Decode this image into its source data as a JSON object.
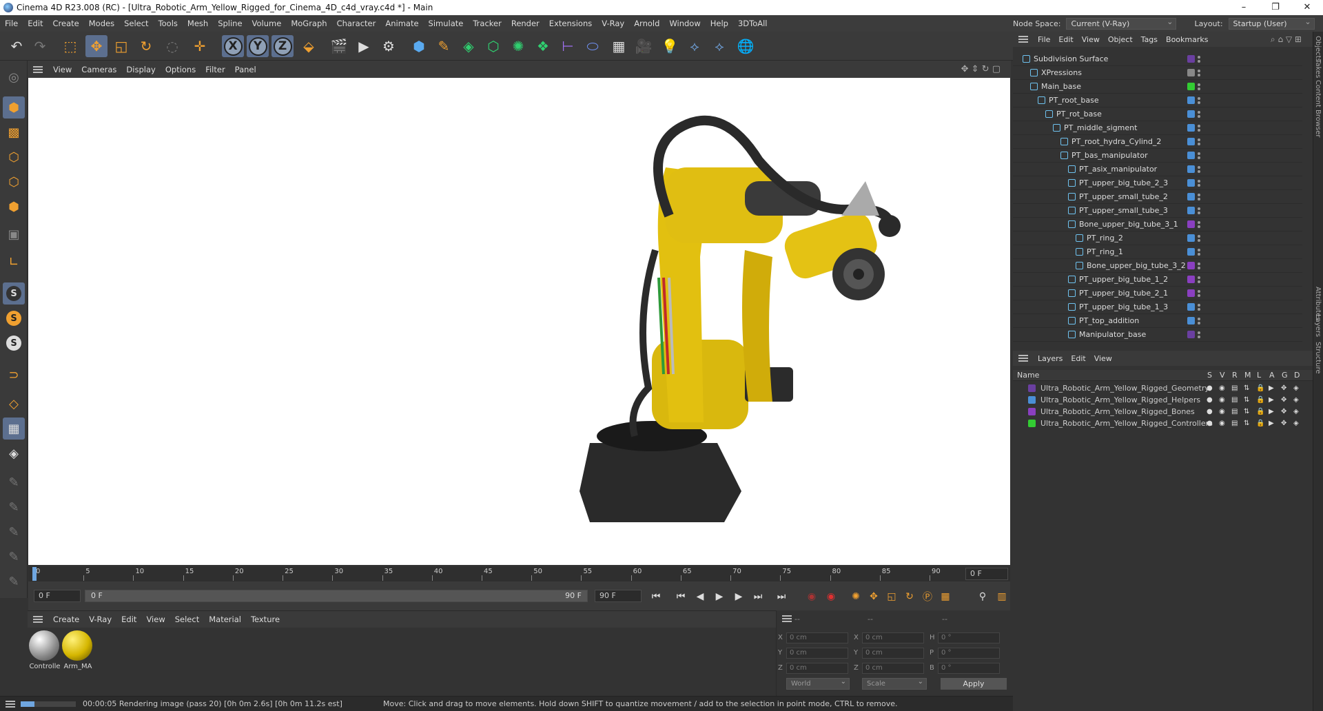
{
  "window": {
    "title": "Cinema 4D R23.008 (RC) - [Ultra_Robotic_Arm_Yellow_Rigged_for_Cinema_4D_c4d_vray.c4d *] - Main",
    "min": "–",
    "max": "❐",
    "close": "✕"
  },
  "menu": [
    "File",
    "Edit",
    "Create",
    "Modes",
    "Select",
    "Tools",
    "Mesh",
    "Spline",
    "Volume",
    "MoGraph",
    "Character",
    "Animate",
    "Simulate",
    "Tracker",
    "Render",
    "Extensions",
    "V-Ray",
    "Arnold",
    "Window",
    "Help",
    "3DToAll"
  ],
  "nodespace": {
    "label": "Node Space:",
    "value": "Current (V-Ray)",
    "layout_label": "Layout:",
    "layout_value": "Startup (User)"
  },
  "viewport_menu": [
    "View",
    "Cameras",
    "Display",
    "Options",
    "Filter",
    "Panel"
  ],
  "timeline": {
    "ticks": [
      "0",
      "5",
      "10",
      "15",
      "20",
      "25",
      "30",
      "35",
      "40",
      "45",
      "50",
      "55",
      "60",
      "65",
      "70",
      "75",
      "80",
      "85",
      "90"
    ],
    "current": "0 F"
  },
  "transport": {
    "start": "0 F",
    "range_start": "0 F",
    "range_end": "90 F",
    "end": "90 F"
  },
  "material_menu": [
    "Create",
    "V-Ray",
    "Edit",
    "View",
    "Select",
    "Material",
    "Texture"
  ],
  "materials": [
    {
      "name": "Controlle"
    },
    {
      "name": "Arm_MA"
    }
  ],
  "coords": {
    "h1": "--",
    "h2": "--",
    "h3": "--",
    "rows": [
      {
        "a": "X",
        "av": "0 cm",
        "b": "X",
        "bv": "0 cm",
        "c": "H",
        "cv": "0 °"
      },
      {
        "a": "Y",
        "av": "0 cm",
        "b": "Y",
        "bv": "0 cm",
        "c": "P",
        "cv": "0 °"
      },
      {
        "a": "Z",
        "av": "0 cm",
        "b": "Z",
        "bv": "0 cm",
        "c": "B",
        "cv": "0 °"
      }
    ],
    "world": "World",
    "scale": "Scale",
    "apply": "Apply"
  },
  "status": {
    "render": "00:00:05 Rendering image (pass 20) [0h  0m  2.6s] [0h  0m 11.2s est]",
    "hint": "Move: Click and drag to move elements. Hold down SHIFT to quantize movement / add to the selection in point mode, CTRL to remove."
  },
  "objects_menu": [
    "File",
    "Edit",
    "View",
    "Object",
    "Tags",
    "Bookmarks"
  ],
  "objects": [
    {
      "name": "Subdivision Surface",
      "indent": 0,
      "color": "#6a3fa0"
    },
    {
      "name": "XPressions",
      "indent": 1,
      "color": "#888888"
    },
    {
      "name": "Main_base",
      "indent": 1,
      "color": "#33cc33"
    },
    {
      "name": "PT_root_base",
      "indent": 2,
      "color": "#4a8fd6"
    },
    {
      "name": "PT_rot_base",
      "indent": 3,
      "color": "#4a8fd6"
    },
    {
      "name": "PT_middle_sigment",
      "indent": 4,
      "color": "#4a8fd6"
    },
    {
      "name": "PT_root_hydra_Cylind_2",
      "indent": 5,
      "color": "#4a8fd6"
    },
    {
      "name": "PT_bas_manipulator",
      "indent": 5,
      "color": "#4a8fd6"
    },
    {
      "name": "PT_asix_manipulator",
      "indent": 6,
      "color": "#4a8fd6"
    },
    {
      "name": "PT_upper_big_tube_2_3",
      "indent": 6,
      "color": "#4a8fd6"
    },
    {
      "name": "PT_upper_small_tube_2",
      "indent": 6,
      "color": "#4a8fd6"
    },
    {
      "name": "PT_upper_small_tube_3",
      "indent": 6,
      "color": "#4a8fd6"
    },
    {
      "name": "Bone_upper_big_tube_3_1",
      "indent": 6,
      "color": "#8a3fc0"
    },
    {
      "name": "PT_ring_2",
      "indent": 7,
      "color": "#4a8fd6"
    },
    {
      "name": "PT_ring_1",
      "indent": 7,
      "color": "#4a8fd6"
    },
    {
      "name": "Bone_upper_big_tube_3_2",
      "indent": 7,
      "color": "#8a3fc0"
    },
    {
      "name": "PT_upper_big_tube_1_2",
      "indent": 6,
      "color": "#8a3fc0"
    },
    {
      "name": "PT_upper_big_tube_2_1",
      "indent": 6,
      "color": "#8a3fc0"
    },
    {
      "name": "PT_upper_big_tube_1_3",
      "indent": 6,
      "color": "#4a8fd6"
    },
    {
      "name": "PT_top_addition",
      "indent": 6,
      "color": "#4a8fd6"
    },
    {
      "name": "Manipulator_base",
      "indent": 6,
      "color": "#6a3fa0"
    }
  ],
  "layers_menu": [
    "Layers",
    "Edit",
    "View"
  ],
  "layers_header": {
    "name": "Name",
    "cols": [
      "S",
      "V",
      "R",
      "M",
      "L",
      "A",
      "G",
      "D"
    ]
  },
  "layers": [
    {
      "name": "Ultra_Robotic_Arm_Yellow_Rigged_Geometry",
      "color": "#6a3fa0"
    },
    {
      "name": "Ultra_Robotic_Arm_Yellow_Rigged_Helpers",
      "color": "#4a8fd6"
    },
    {
      "name": "Ultra_Robotic_Arm_Yellow_Rigged_Bones",
      "color": "#8a3fc0"
    },
    {
      "name": "Ultra_Robotic_Arm_Yellow_Rigged_Controllers",
      "color": "#33cc33"
    }
  ],
  "right_tabs": [
    "Objects",
    "Takes",
    "Content Browser",
    "Attributes",
    "Layers",
    "Structure"
  ]
}
